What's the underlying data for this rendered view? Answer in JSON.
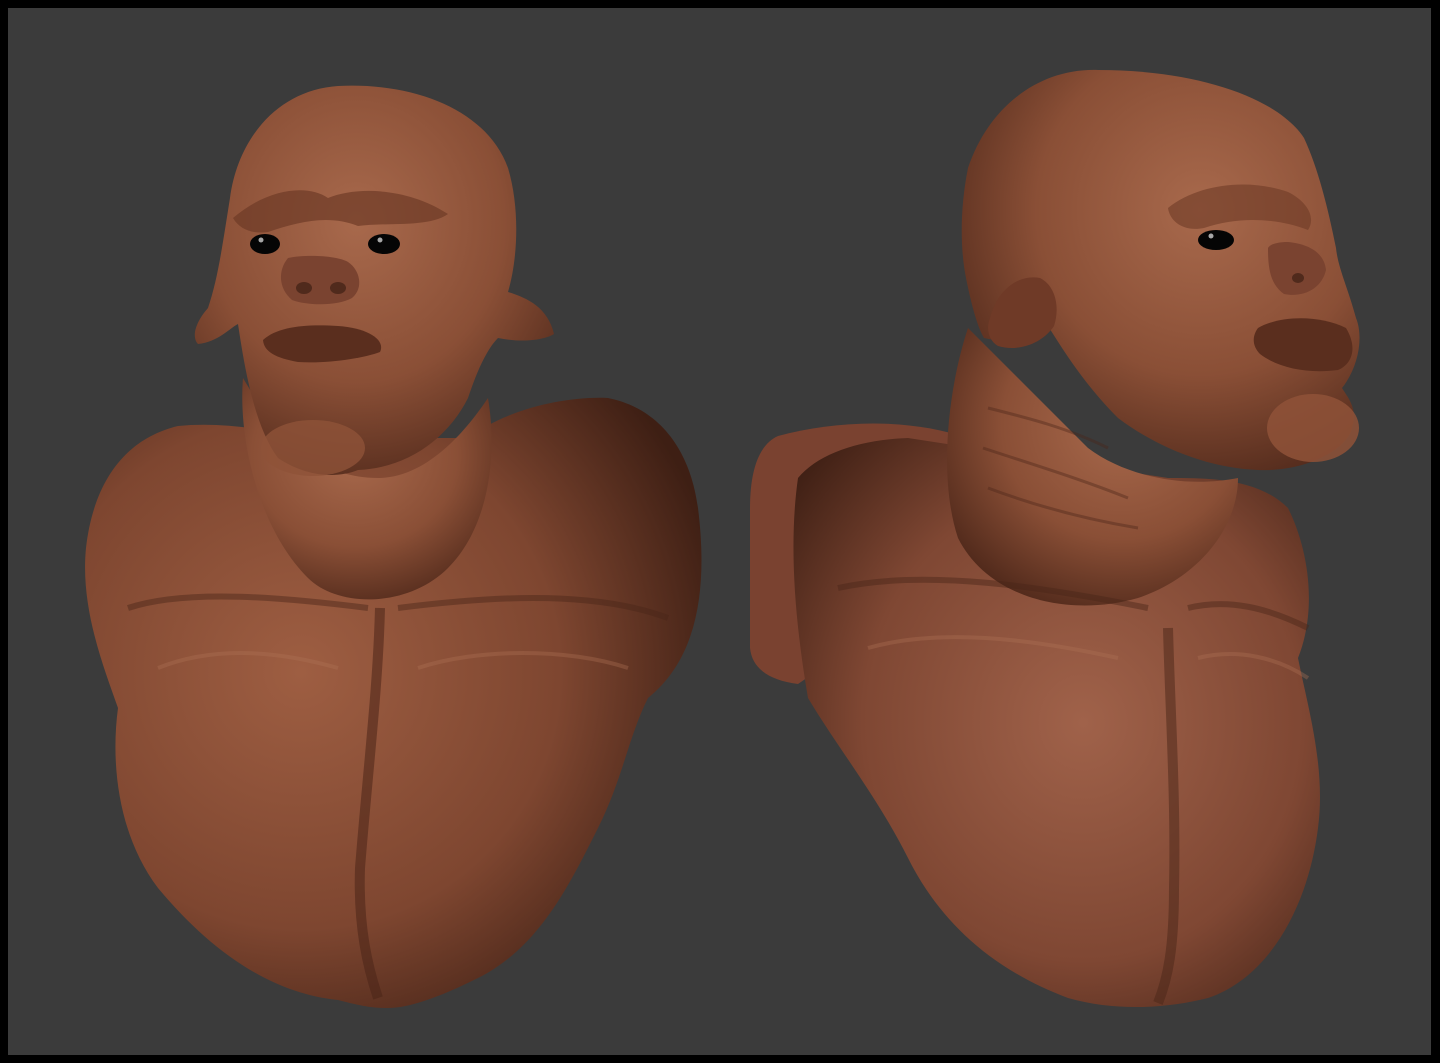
{
  "scene": {
    "background_color": "#3b3b3b",
    "border_color": "#000000",
    "skin_color": "#8a4f36",
    "skin_highlight": "#a8694c",
    "skin_shadow": "#4a2518",
    "eye_color": "#050505"
  },
  "sculpts": [
    {
      "name": "bust-front-view"
    },
    {
      "name": "bust-three-quarter-view"
    }
  ]
}
